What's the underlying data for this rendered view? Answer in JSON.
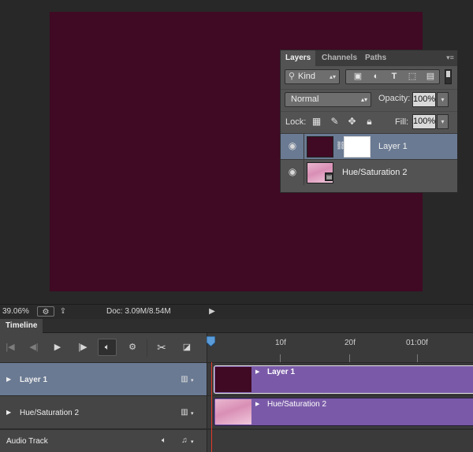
{
  "colors": {
    "canvas": "#400a24",
    "selected_row": "#6a7a93",
    "clip": "#7a5aa8",
    "playhead": "#e23a2a"
  },
  "layers_panel": {
    "tabs": [
      {
        "label": "Layers",
        "active": true
      },
      {
        "label": "Channels",
        "active": false
      },
      {
        "label": "Paths",
        "active": false
      }
    ],
    "menu_icon": "panel-menu-icon",
    "filter": {
      "kind_label": "Kind",
      "icons": [
        "pixel-filter-icon",
        "adjustment-filter-icon",
        "type-filter-icon",
        "shape-filter-icon",
        "smart-object-filter-icon"
      ]
    },
    "blend_mode": "Normal",
    "opacity_label": "Opacity:",
    "opacity_value": "100%",
    "lock_label": "Lock:",
    "lock_icons": [
      "lock-transparency-icon",
      "lock-pixels-icon",
      "lock-position-icon",
      "lock-all-icon"
    ],
    "fill_label": "Fill:",
    "fill_value": "100%",
    "layers": [
      {
        "name": "Layer 1",
        "selected": true,
        "visible": true
      },
      {
        "name": "Hue/Saturation 2",
        "selected": false,
        "visible": true
      }
    ]
  },
  "status_bar": {
    "zoom": "39.06%",
    "doc": "Doc: 3.09M/8.54M"
  },
  "timeline": {
    "tab_label": "Timeline",
    "ruler_labels": [
      "10f",
      "20f",
      "01:00f"
    ],
    "tracks": [
      {
        "name": "Layer 1",
        "selected": true,
        "clip_label": "Layer 1"
      },
      {
        "name": "Hue/Saturation 2",
        "selected": false,
        "clip_label": "Hue/Saturation 2"
      }
    ],
    "audio_track_label": "Audio Track"
  }
}
